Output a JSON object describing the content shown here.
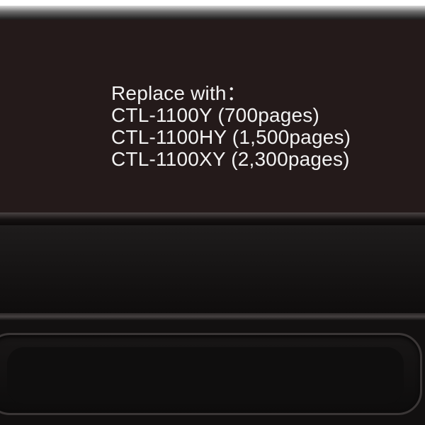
{
  "label": {
    "lines": [
      "Replace with：",
      "CTL-1100Y (700pages)",
      "CTL-1100HY (1,500pages)",
      "CTL-1100XY (2,300pages)"
    ]
  },
  "colors": {
    "label_background": "#241a1a",
    "text": "#f2f2f2",
    "cartridge_body": "#141212"
  }
}
